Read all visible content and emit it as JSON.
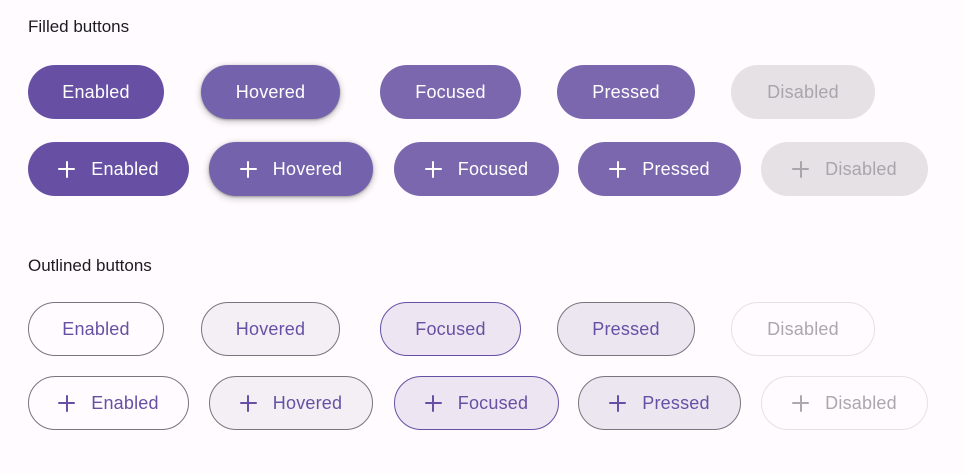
{
  "sections": {
    "filled_title": "Filled buttons",
    "outlined_title": "Outlined buttons"
  },
  "filled": {
    "row1": {
      "enabled": "Enabled",
      "hovered": "Hovered",
      "focused": "Focused",
      "pressed": "Pressed",
      "disabled": "Disabled"
    },
    "row2": {
      "enabled": "Enabled",
      "hovered": "Hovered",
      "focused": "Focused",
      "pressed": "Pressed",
      "disabled": "Disabled"
    }
  },
  "outlined": {
    "row1": {
      "enabled": "Enabled",
      "hovered": "Hovered",
      "focused": "Focused",
      "pressed": "Pressed",
      "disabled": "Disabled"
    },
    "row2": {
      "enabled": "Enabled",
      "hovered": "Hovered",
      "focused": "Focused",
      "pressed": "Pressed",
      "disabled": "Disabled"
    }
  },
  "icons": {
    "leading": "plus-icon"
  },
  "colors": {
    "primary": "#6750A4",
    "on_primary": "#FFFFFF",
    "outline": "#79747E",
    "disabled_container": "#E6E1E5",
    "surface": "#FFFBFE"
  }
}
